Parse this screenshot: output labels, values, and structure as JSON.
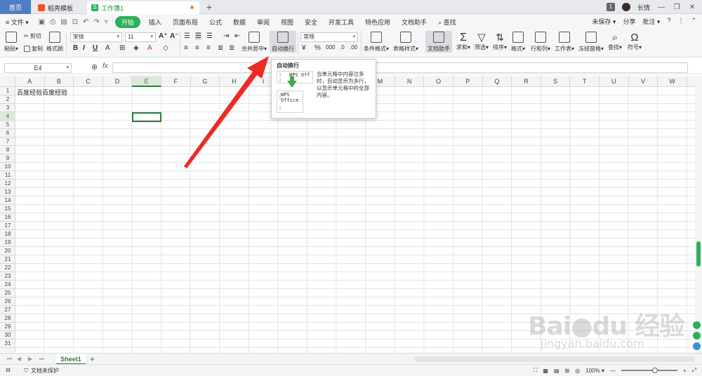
{
  "titlebar": {
    "home": "首页",
    "template": "稻壳模板",
    "workbook": "工作簿1",
    "page_badge": "1",
    "user": "长情"
  },
  "menu": {
    "file": "≡ 文件 ▾",
    "start": "开始",
    "insert": "插入",
    "layout": "页面布局",
    "formulas": "公式",
    "data": "数据",
    "review": "审阅",
    "view": "视图",
    "security": "安全",
    "developer": "开发工具",
    "features": "特色应用",
    "doc_helper": "文档助手",
    "search": "查找",
    "unsaved": "未保存 ▾",
    "share": "分享",
    "comment": "批注 ▾"
  },
  "ribbon": {
    "paste": "粘贴▾",
    "cut": "剪切",
    "copy": "复制",
    "format_painter": "格式刷",
    "font": "宋体",
    "font_size": "11",
    "merge": "合并居中▾",
    "wrap": "自动换行",
    "number_format": "常规",
    "conditional": "条件格式▾",
    "table_style": "表格样式▾",
    "doc_helper": "文档助手",
    "sum": "求和▾",
    "filter": "筛选▾",
    "sort": "排序▾",
    "format": "格式▾",
    "rows_cols": "行和列▾",
    "worksheet": "工作表▾",
    "freeze": "冻结窗格▾",
    "find": "查找▾",
    "symbol": "符号▾"
  },
  "formula": {
    "name_box": "E4",
    "fx": "fx"
  },
  "sheet": {
    "columns": [
      "A",
      "B",
      "C",
      "D",
      "E",
      "F",
      "G",
      "H",
      "I",
      "J",
      "K",
      "L",
      "M",
      "N",
      "O",
      "P",
      "Q",
      "R",
      "S",
      "T",
      "U",
      "V",
      "W"
    ],
    "row_count": 31,
    "selected_col": "E",
    "selected_row": 4,
    "a1": "百度经验百度经验",
    "tab": "Sheet1"
  },
  "tooltip": {
    "title": "自动换行",
    "description": "当单元格中内容过多时，自动显示为多行，以显示单元格中的全部内容。",
    "example_before": "WPS Off",
    "example_after": "WPS Office"
  },
  "status": {
    "protection": "文档未保护",
    "zoom": "100% ▾"
  },
  "watermark": {
    "logo": "Baidu 经验",
    "url": "jingyan.baidu.com"
  }
}
